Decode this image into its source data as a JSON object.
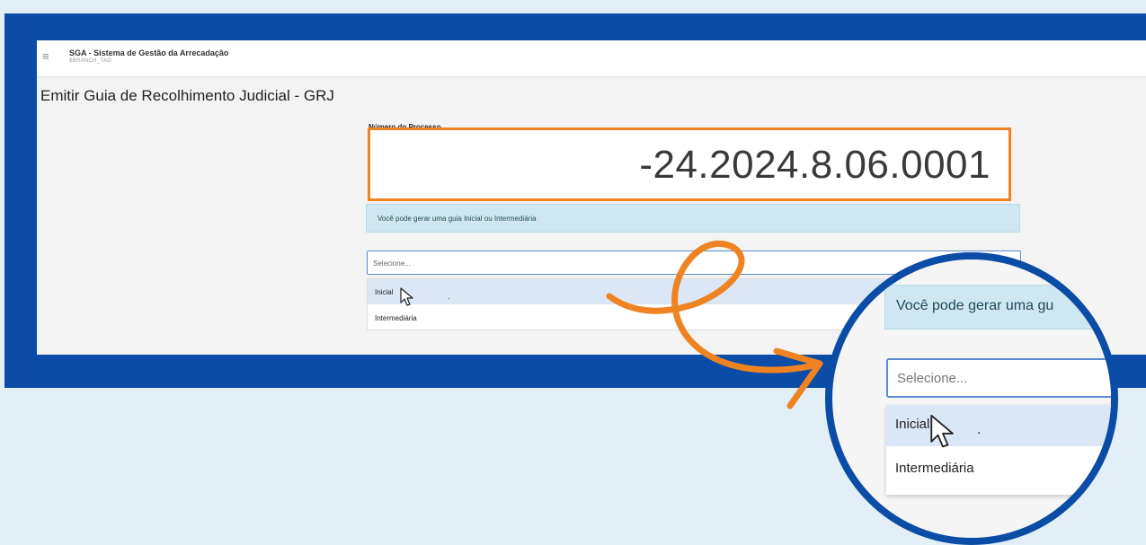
{
  "app": {
    "title": "SGA - Sistema de Gestão da Arrecadação",
    "subtitle": "$BRANCH_TAG"
  },
  "page": {
    "title": "Emitir Guia de Recolhimento Judicial - GRJ"
  },
  "form": {
    "process_label": "Número do Processo",
    "process_value": "-24.2024.8.06.0001",
    "info_text": "Você pode gerar uma guia Inicial ou Intermediária",
    "select_placeholder": "Selecione...",
    "options": [
      "Inicial",
      "Intermediária"
    ],
    "hovered_option": "Inicial"
  },
  "zoom": {
    "info_text": "Você pode gerar uma gu",
    "select_placeholder": "Selecione...",
    "options": [
      "Inicial",
      "Intermediária"
    ],
    "hovered_option": "Inicial"
  },
  "colors": {
    "frame": "#0a4ca6",
    "highlight": "#ef8322",
    "info_background": "#cfe7f0",
    "background": "#e3eff7"
  },
  "icons": [
    "menu-icon",
    "mouse-cursor-icon"
  ]
}
